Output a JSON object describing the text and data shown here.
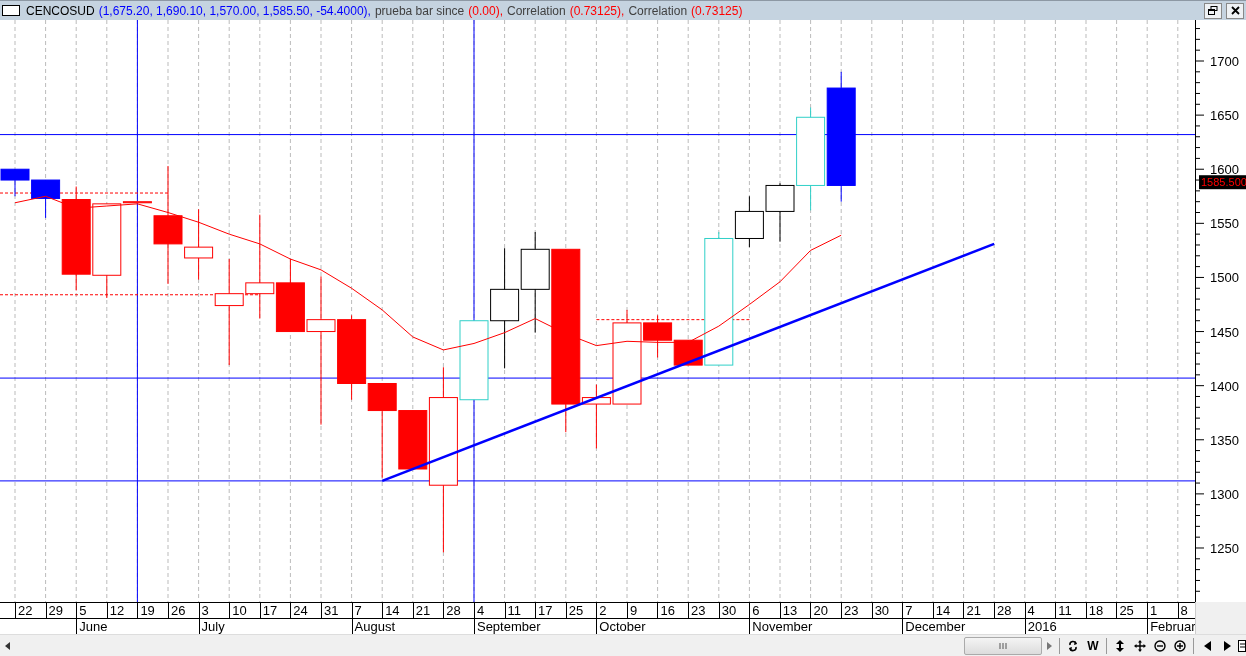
{
  "title_bar": {
    "segments": [
      {
        "text": "CENCOSUD",
        "color": "#000000"
      },
      {
        "text": "(1,675.20, 1,690.10, 1,570.00, 1,585.50, -54.4000),",
        "color": "#0000ff"
      },
      {
        "text": "prueba bar since",
        "color": "#404040"
      },
      {
        "text": "(0.00),",
        "color": "#ff0000"
      },
      {
        "text": "Correlation",
        "color": "#404040"
      },
      {
        "text": "(0.73125),",
        "color": "#ff0000"
      },
      {
        "text": "Correlation",
        "color": "#404040"
      },
      {
        "text": "(0.73125)",
        "color": "#ff0000"
      }
    ]
  },
  "price_axis": {
    "labels": [
      "1700",
      "1650",
      "1600",
      "1550",
      "1500",
      "1450",
      "1400",
      "1350",
      "1300",
      "1250"
    ],
    "last_price_label": "1585.500"
  },
  "date_axis": {
    "dates": [
      {
        "label": "22"
      },
      {
        "label": "29"
      },
      {
        "label": "5",
        "month": "June"
      },
      {
        "label": "12"
      },
      {
        "label": "19"
      },
      {
        "label": "26"
      },
      {
        "label": "3",
        "month": "July"
      },
      {
        "label": "10"
      },
      {
        "label": "17"
      },
      {
        "label": "24"
      },
      {
        "label": "31"
      },
      {
        "label": "7",
        "month": "August"
      },
      {
        "label": "14"
      },
      {
        "label": "21"
      },
      {
        "label": "28"
      },
      {
        "label": "4",
        "month": "September"
      },
      {
        "label": "11"
      },
      {
        "label": "17"
      },
      {
        "label": "25"
      },
      {
        "label": "2",
        "month": "October"
      },
      {
        "label": "9"
      },
      {
        "label": "16"
      },
      {
        "label": "23"
      },
      {
        "label": "30"
      },
      {
        "label": "6",
        "month": "November"
      },
      {
        "label": "13"
      },
      {
        "label": "20"
      },
      {
        "label": "23"
      },
      {
        "label": "30"
      },
      {
        "label": "7",
        "month": "December"
      },
      {
        "label": "14"
      },
      {
        "label": "21"
      },
      {
        "label": "28"
      },
      {
        "label": "4",
        "month": "2016"
      },
      {
        "label": "11"
      },
      {
        "label": "18"
      },
      {
        "label": "25"
      },
      {
        "label": "1",
        "month": "Februar"
      },
      {
        "label": "8"
      }
    ]
  },
  "toolbar": {
    "w_label": "W"
  }
}
